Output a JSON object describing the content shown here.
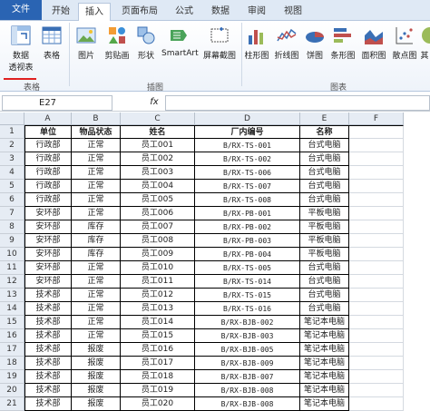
{
  "tabs": [
    {
      "label": "文件"
    },
    {
      "label": "开始"
    },
    {
      "label": "插入"
    },
    {
      "label": "页面布局"
    },
    {
      "label": "公式"
    },
    {
      "label": "数据"
    },
    {
      "label": "审阅"
    },
    {
      "label": "视图"
    }
  ],
  "ribbon": {
    "pivot_label1": "数据",
    "pivot_label2": "透视表",
    "table_label": "表格",
    "group_tables": "表格",
    "picture_label": "图片",
    "clipart_label": "剪贴画",
    "shapes_label": "形状",
    "smartart_label": "SmartArt",
    "screenshot_label": "屏幕截图",
    "group_illustrations": "插图",
    "column_chart_label": "柱形图",
    "line_chart_label": "折线图",
    "pie_chart_label": "饼图",
    "bar_chart_label": "条形图",
    "area_chart_label": "面积图",
    "scatter_chart_label": "散点图",
    "other_chart_label": "其",
    "group_charts": "图表"
  },
  "formula_bar": {
    "name_box": "E27",
    "fx": "fx",
    "formula": ""
  },
  "columns": [
    "A",
    "B",
    "C",
    "D",
    "E",
    "F"
  ],
  "rows": [
    {
      "n": "1",
      "cells": [
        "单位",
        "物品状态",
        "姓名",
        "厂内编号",
        "名称"
      ]
    },
    {
      "n": "2",
      "cells": [
        "行政部",
        "正常",
        "员工001",
        "B/RX-TS-001",
        "台式电脑"
      ]
    },
    {
      "n": "3",
      "cells": [
        "行政部",
        "正常",
        "员工002",
        "B/RX-TS-002",
        "台式电脑"
      ]
    },
    {
      "n": "4",
      "cells": [
        "行政部",
        "正常",
        "员工003",
        "B/RX-TS-006",
        "台式电脑"
      ]
    },
    {
      "n": "5",
      "cells": [
        "行政部",
        "正常",
        "员工004",
        "B/RX-TS-007",
        "台式电脑"
      ]
    },
    {
      "n": "6",
      "cells": [
        "行政部",
        "正常",
        "员工005",
        "B/RX-TS-008",
        "台式电脑"
      ]
    },
    {
      "n": "7",
      "cells": [
        "安环部",
        "正常",
        "员工006",
        "B/RX-PB-001",
        "平板电脑"
      ]
    },
    {
      "n": "8",
      "cells": [
        "安环部",
        "库存",
        "员工007",
        "B/RX-PB-002",
        "平板电脑"
      ]
    },
    {
      "n": "9",
      "cells": [
        "安环部",
        "库存",
        "员工008",
        "B/RX-PB-003",
        "平板电脑"
      ]
    },
    {
      "n": "10",
      "cells": [
        "安环部",
        "库存",
        "员工009",
        "B/RX-PB-004",
        "平板电脑"
      ]
    },
    {
      "n": "11",
      "cells": [
        "安环部",
        "正常",
        "员工010",
        "B/RX-TS-005",
        "台式电脑"
      ]
    },
    {
      "n": "12",
      "cells": [
        "安环部",
        "正常",
        "员工011",
        "B/RX-TS-014",
        "台式电脑"
      ]
    },
    {
      "n": "13",
      "cells": [
        "技术部",
        "正常",
        "员工012",
        "B/RX-TS-015",
        "台式电脑"
      ]
    },
    {
      "n": "14",
      "cells": [
        "技术部",
        "正常",
        "员工013",
        "B/RX-TS-016",
        "台式电脑"
      ]
    },
    {
      "n": "15",
      "cells": [
        "技术部",
        "正常",
        "员工014",
        "B/RX-BJB-002",
        "笔记本电脑"
      ]
    },
    {
      "n": "16",
      "cells": [
        "技术部",
        "正常",
        "员工015",
        "B/RX-BJB-003",
        "笔记本电脑"
      ]
    },
    {
      "n": "17",
      "cells": [
        "技术部",
        "报废",
        "员工016",
        "B/RX-BJB-005",
        "笔记本电脑"
      ]
    },
    {
      "n": "18",
      "cells": [
        "技术部",
        "报废",
        "员工017",
        "B/RX-BJB-009",
        "笔记本电脑"
      ]
    },
    {
      "n": "19",
      "cells": [
        "技术部",
        "报废",
        "员工018",
        "B/RX-BJB-007",
        "笔记本电脑"
      ]
    },
    {
      "n": "20",
      "cells": [
        "技术部",
        "报废",
        "员工019",
        "B/RX-BJB-008",
        "笔记本电脑"
      ]
    },
    {
      "n": "21",
      "cells": [
        "技术部",
        "报废",
        "员工020",
        "B/RX-BJB-008",
        "笔记本电脑"
      ]
    }
  ]
}
